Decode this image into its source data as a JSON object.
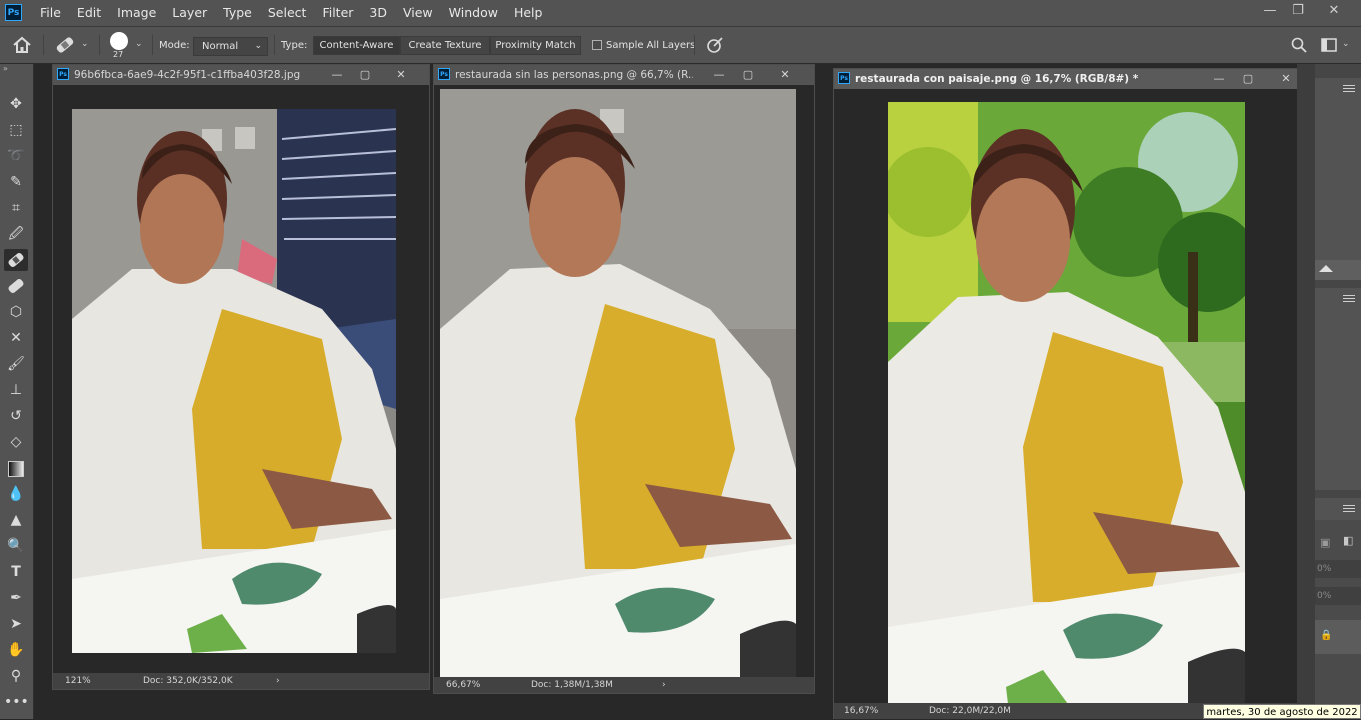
{
  "app": {
    "logo": "Ps"
  },
  "menu": [
    "File",
    "Edit",
    "Image",
    "Layer",
    "Type",
    "Select",
    "Filter",
    "3D",
    "View",
    "Window",
    "Help"
  ],
  "window_controls": {
    "minimize": "—",
    "restore": "❐",
    "close": "✕"
  },
  "options": {
    "brush_size": "27",
    "mode_label": "Mode:",
    "mode_value": "Normal",
    "type_label": "Type:",
    "type_buttons": [
      "Content-Aware",
      "Create Texture",
      "Proximity Match"
    ],
    "sample_all_layers": "Sample All Layers",
    "sample_all_layers_checked": false
  },
  "tool_icons": [
    "move-icon",
    "marquee-icon",
    "lasso-icon",
    "quick-select-icon",
    "crop-icon",
    "eyedropper-icon",
    "spot-healing-brush-icon",
    "healing-brush-icon",
    "patch-icon",
    "red-eye-icon",
    "brush-icon",
    "clone-stamp-icon",
    "history-brush-icon",
    "eraser-icon",
    "gradient-icon",
    "blur-icon",
    "sharpen-icon",
    "dodge-icon",
    "type-icon",
    "pen-icon",
    "path-select-icon",
    "hand-icon",
    "zoom-icon",
    "more-icon"
  ],
  "documents": [
    {
      "title": "96b6fbca-6ae9-4c2f-95f1-c1ffba403f28.jpg @...",
      "zoom": "121%",
      "doc": "Doc: 352,0K/352,0K"
    },
    {
      "title": "restaurada sin las personas.png @ 66,7% (R...",
      "zoom": "66,67%",
      "doc": "Doc: 1,38M/1,38M"
    },
    {
      "title": "restaurada con paisaje.png @ 16,7% (RGB/8#) *",
      "zoom": "16,67%",
      "doc": "Doc: 22,0M/22,0M"
    }
  ],
  "right_panel": {
    "percent_1": "0%",
    "percent_2": "0%"
  },
  "tooltip": "martes, 30 de agosto de 2022",
  "colors": {
    "panel": "#535353",
    "bg": "#282828",
    "accent": "#31a8ff"
  }
}
